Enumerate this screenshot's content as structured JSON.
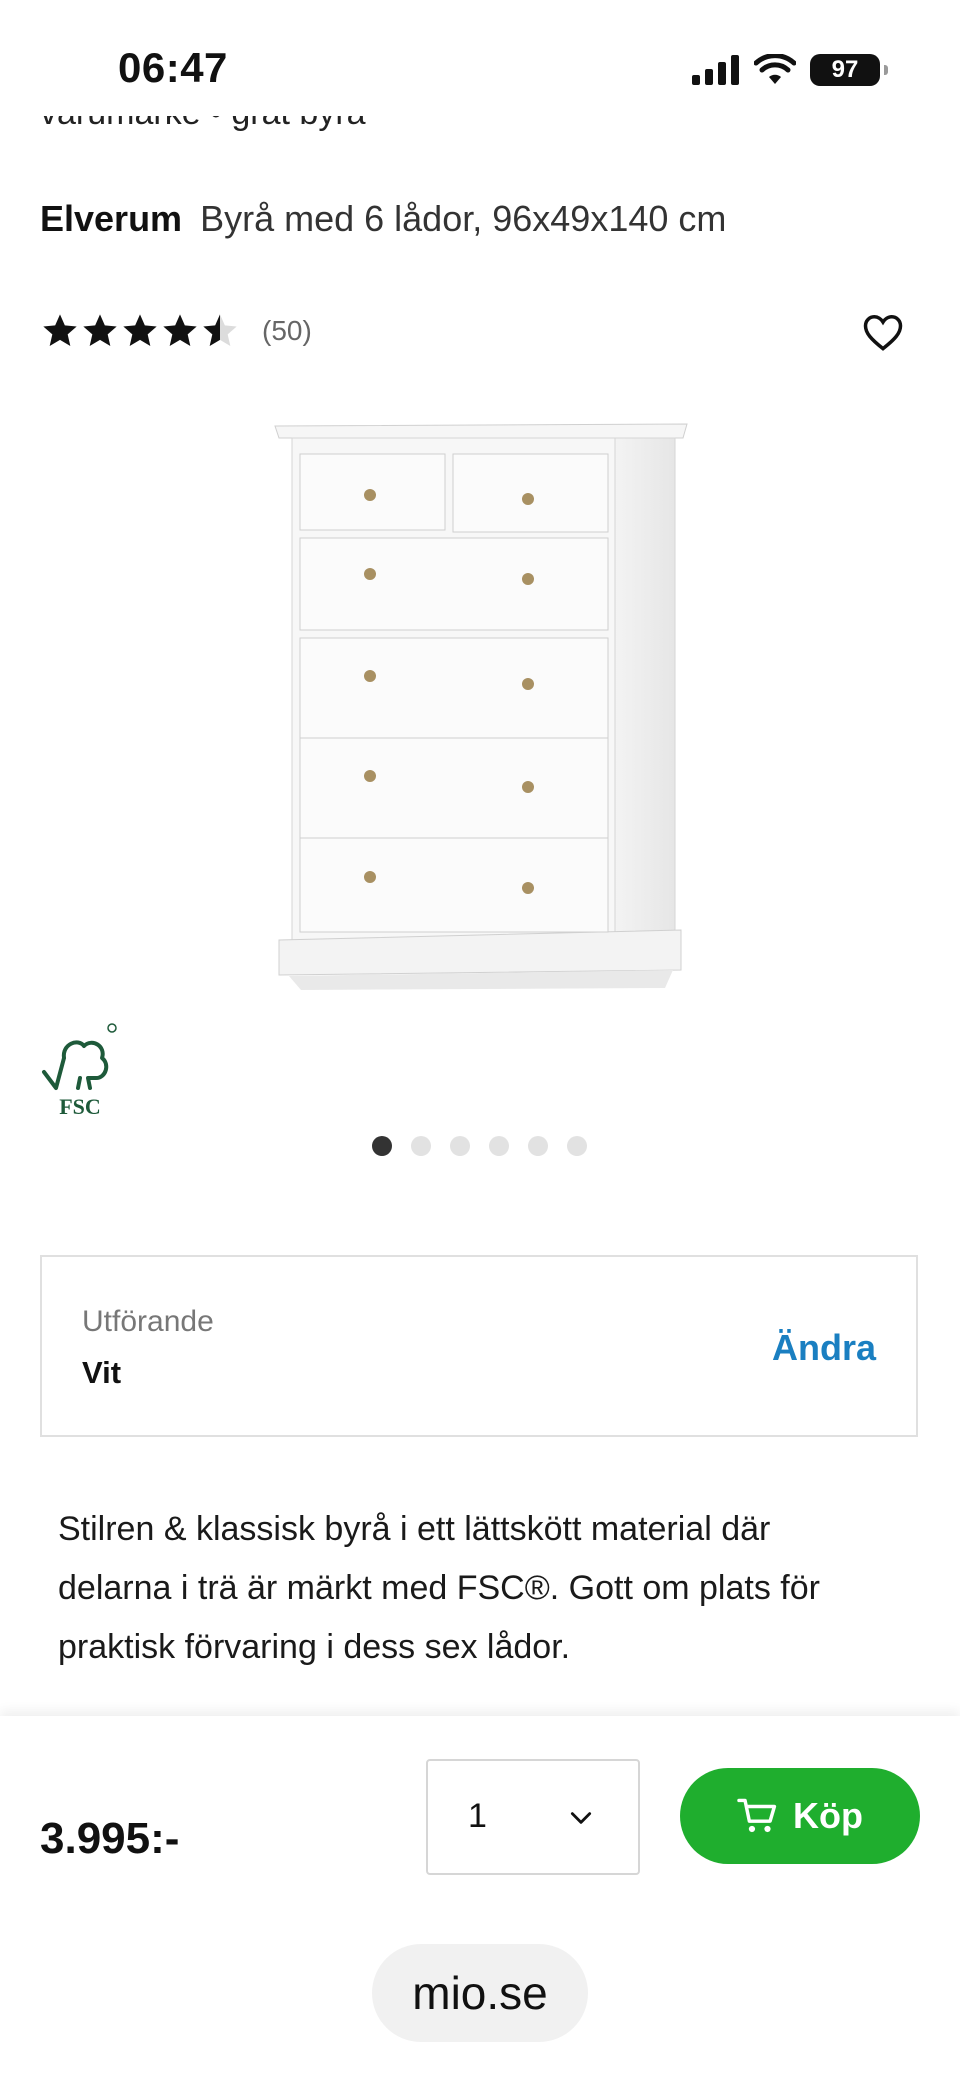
{
  "status_bar": {
    "time": "06:47",
    "battery": "97",
    "icons": [
      "signal-icon",
      "wifi-icon",
      "battery-icon"
    ]
  },
  "cut_text": "varumärke • gråt byrå",
  "product": {
    "brand": "Elverum",
    "name": "Byrå med 6 lådor, 96x49x140 cm",
    "rating": 4.5,
    "review_count": "(50)",
    "image_alt": "white-chest-of-six-drawers",
    "certification": "FSC"
  },
  "carousel": {
    "total": 6,
    "active": 1
  },
  "variant": {
    "label": "Utförande",
    "value": "Vit",
    "change_label": "Ändra"
  },
  "description": "Stilren & klassisk byrå i ett lättskött material där delarna i trä är märkt med FSC®. Gott om plats för praktisk förvaring i dess sex lådor.",
  "purchase": {
    "price": "3.995:-",
    "quantity": "1",
    "buy_label": "Köp"
  },
  "browser": {
    "url": "mio.se"
  },
  "colors": {
    "buy_button": "#1fae2e",
    "link": "#1a7fc1",
    "fsc_green": "#1e5a3a"
  }
}
